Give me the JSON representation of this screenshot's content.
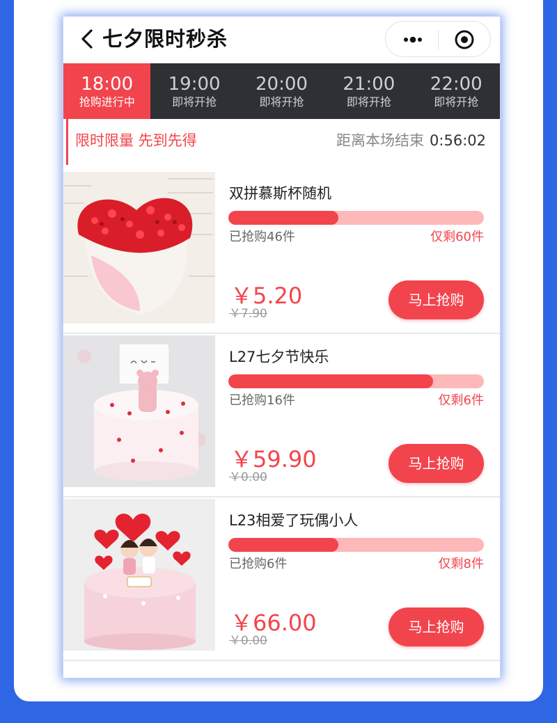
{
  "header": {
    "title": "七夕限时秒杀"
  },
  "tabs": [
    {
      "time": "18:00",
      "status": "抢购进行中",
      "active": true
    },
    {
      "time": "19:00",
      "status": "即将开抢",
      "active": false
    },
    {
      "time": "20:00",
      "status": "即将开抢",
      "active": false
    },
    {
      "time": "21:00",
      "status": "即将开抢",
      "active": false
    },
    {
      "time": "22:00",
      "status": "即将开抢",
      "active": false
    }
  ],
  "notice": {
    "slogan": "限时限量 先到先得",
    "countdown_label": "距离本场结束",
    "countdown": "0:56:02"
  },
  "products": [
    {
      "name": "双拼慕斯杯随机",
      "sold": "已抢购46件",
      "remaining": "仅剩60件",
      "progress": 0.43,
      "price": "￥5.20",
      "old_price": "￥7.90",
      "button": "马上抢购",
      "image_icon": "heart-cake-image"
    },
    {
      "name": "L27七夕节快乐",
      "sold": "已抢购16件",
      "remaining": "仅剩6件",
      "progress": 0.8,
      "price": "￥59.90",
      "old_price": "￥0.00",
      "button": "马上抢购",
      "image_icon": "bear-cake-image"
    },
    {
      "name": "L23相爱了玩偶小人",
      "sold": "已抢购6件",
      "remaining": "仅剩8件",
      "progress": 0.43,
      "price": "￥66.00",
      "old_price": "￥0.00",
      "button": "马上抢购",
      "image_icon": "couple-cake-image"
    }
  ],
  "colors": {
    "background": "#2f66e4",
    "accent": "#f2444d",
    "tab_bar": "#2e3035",
    "progress_track": "#fdb8b9"
  }
}
